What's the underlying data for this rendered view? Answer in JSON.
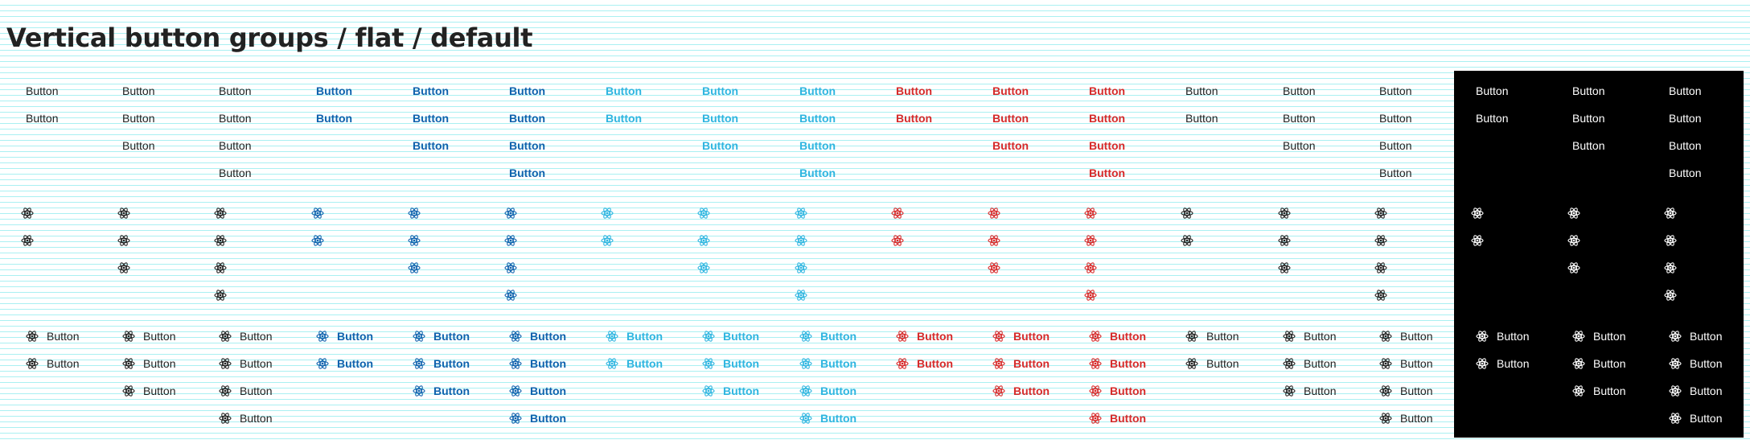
{
  "page_title": "Vertical button groups / flat / default",
  "button_label": "Button",
  "icon": "react-atom-icon",
  "colors": {
    "default": "#222222",
    "primary": "#0f62ad",
    "secondary": "#2fb5e0",
    "danger": "#d62a2a",
    "inverse": "#ffffff",
    "inverse_background": "#000000"
  },
  "group_variants": [
    "default",
    "default",
    "default",
    "primary",
    "primary",
    "primary",
    "secondary",
    "secondary",
    "secondary",
    "danger",
    "danger",
    "danger",
    "plain",
    "plain",
    "plain",
    "inverse",
    "inverse",
    "inverse"
  ],
  "group_sizes": [
    2,
    3,
    4,
    2,
    3,
    4,
    2,
    3,
    4,
    2,
    3,
    4,
    2,
    3,
    4,
    2,
    3,
    4
  ],
  "sections": [
    "text-only",
    "icon-only",
    "icon-and-text"
  ]
}
